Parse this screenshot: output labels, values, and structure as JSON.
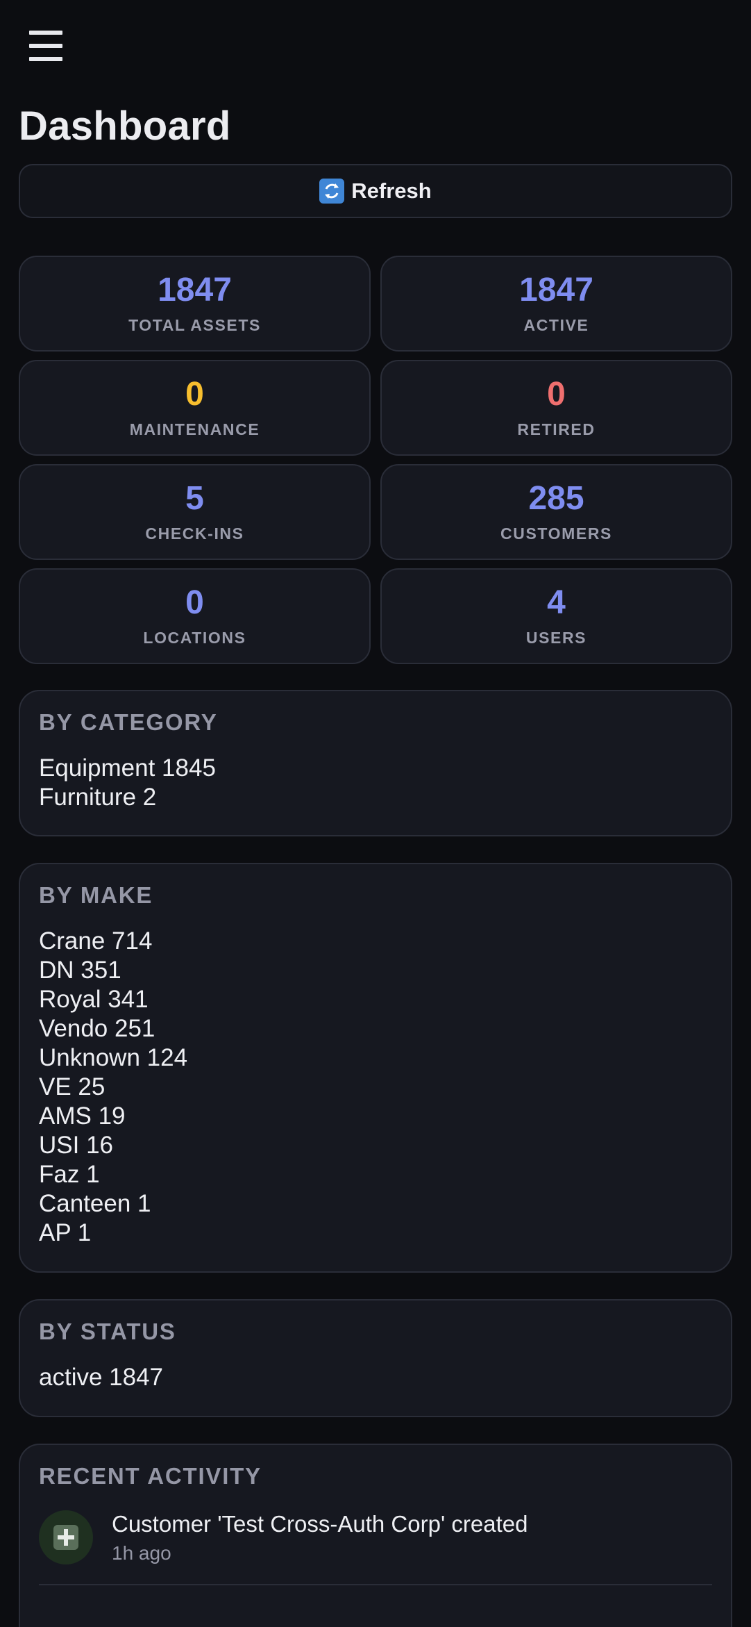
{
  "header": {
    "menu_icon": "hamburger-menu-icon",
    "title": "Dashboard",
    "refresh_icon": "refresh-arrows-icon",
    "refresh_label": "Refresh"
  },
  "colors": {
    "accent_blue": "#7f8df0",
    "warning_yellow": "#f7be2e",
    "danger_red": "#ef6f6f"
  },
  "stats": [
    {
      "value": "1847",
      "label": "TOTAL ASSETS",
      "color": "#7f8df0"
    },
    {
      "value": "1847",
      "label": "ACTIVE",
      "color": "#7f8df0"
    },
    {
      "value": "0",
      "label": "MAINTENANCE",
      "color": "#f7be2e"
    },
    {
      "value": "0",
      "label": "RETIRED",
      "color": "#ef6f6f"
    },
    {
      "value": "5",
      "label": "CHECK-INS",
      "color": "#7f8df0"
    },
    {
      "value": "285",
      "label": "CUSTOMERS",
      "color": "#7f8df0"
    },
    {
      "value": "0",
      "label": "LOCATIONS",
      "color": "#7f8df0"
    },
    {
      "value": "4",
      "label": "USERS",
      "color": "#7f8df0"
    }
  ],
  "by_category": {
    "title": "BY CATEGORY",
    "rows": [
      "Equipment 1845",
      "Furniture 2"
    ]
  },
  "by_make": {
    "title": "BY MAKE",
    "rows": [
      "Crane 714",
      "DN 351",
      "Royal 341",
      "Vendo 251",
      "Unknown 124",
      "VE 25",
      "AMS 19",
      "USI 16",
      "Faz 1",
      "Canteen 1",
      "AP 1"
    ]
  },
  "by_status": {
    "title": "BY STATUS",
    "rows": [
      "active 1847"
    ]
  },
  "recent_activity": {
    "title": "RECENT ACTIVITY",
    "items": [
      {
        "icon": "plus-icon",
        "text": "Customer 'Test Cross-Auth Corp' created",
        "time": "1h ago"
      }
    ]
  }
}
